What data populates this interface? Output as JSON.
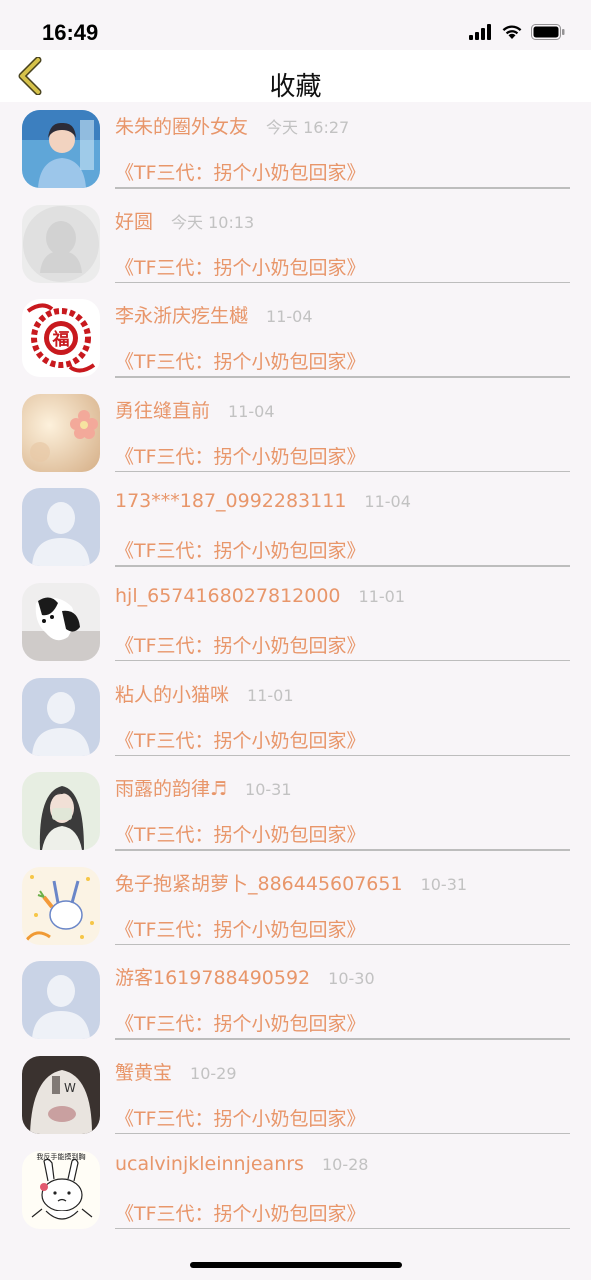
{
  "status_bar": {
    "time": "16:49"
  },
  "nav": {
    "title": "收藏",
    "back_icon": "chevron-left-icon",
    "accent": "#d6c24a"
  },
  "colors": {
    "name": "#e8966a",
    "time": "#c2c2c2",
    "divider": "#bdbdbd",
    "background": "#f8f5f8"
  },
  "items": [
    {
      "name": "朱朱的圈外女友",
      "time": "今天 16:27",
      "link": "《TF三代：拐个小奶包回家》",
      "avatar": "photo-boy"
    },
    {
      "name": "好圆",
      "time": "今天 10:13",
      "link": "《TF三代：拐个小奶包回家》",
      "avatar": "penguin-default"
    },
    {
      "name": "李永浙庆疙生樾",
      "time": "11-04",
      "link": "《TF三代：拐个小奶包回家》",
      "avatar": "fu-papercut"
    },
    {
      "name": "勇往缝直前",
      "time": "11-04",
      "link": "《TF三代：拐个小奶包回家》",
      "avatar": "flower-photo"
    },
    {
      "name": "173***187_0992283111",
      "time": "11-04",
      "link": "《TF三代：拐个小奶包回家》",
      "avatar": "person-default"
    },
    {
      "name": "hjl_6574168027812000",
      "time": "11-01",
      "link": "《TF三代：拐个小奶包回家》",
      "avatar": "dog-photo"
    },
    {
      "name": "粘人的小猫咪",
      "time": "11-01",
      "link": "《TF三代：拐个小奶包回家》",
      "avatar": "person-default"
    },
    {
      "name": "雨露的韵律♬",
      "time": "10-31",
      "link": "《TF三代：拐个小奶包回家》",
      "avatar": "girl-photo"
    },
    {
      "name": "兔子抱紧胡萝卜_886445607651",
      "time": "10-31",
      "link": "《TF三代：拐个小奶包回家》",
      "avatar": "rabbit-drawing"
    },
    {
      "name": "游客1619788490592",
      "time": "10-30",
      "link": "《TF三代：拐个小奶包回家》",
      "avatar": "person-default"
    },
    {
      "name": "蟹黄宝",
      "time": "10-29",
      "link": "《TF三代：拐个小奶包回家》",
      "avatar": "sweater-photo"
    },
    {
      "name": "ucalvinjkleinnjeanrs",
      "time": "10-28",
      "link": "《TF三代：拐个小奶包回家》",
      "avatar": "bunny-sticker",
      "avatar_caption": "我反手能摸到胸"
    }
  ]
}
